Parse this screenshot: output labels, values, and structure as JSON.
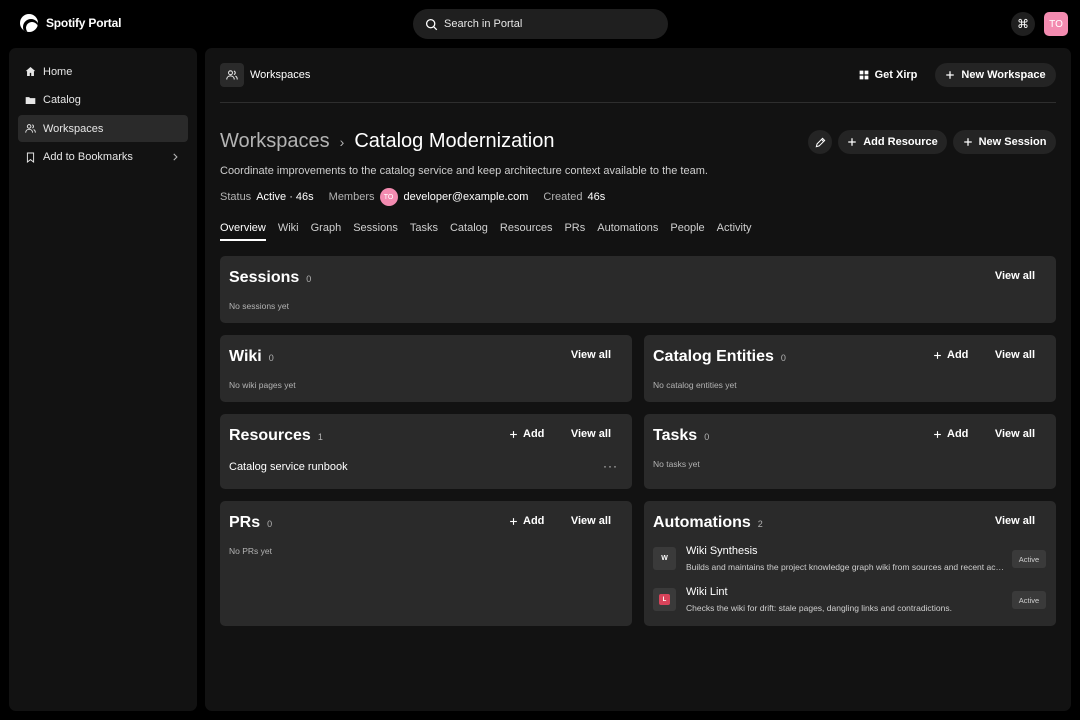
{
  "app": {
    "name": "Spotify Portal"
  },
  "search": {
    "placeholder": "Search in Portal"
  },
  "user": {
    "initials": "TO"
  },
  "sidebar": {
    "items": [
      {
        "label": "Home"
      },
      {
        "label": "Catalog"
      },
      {
        "label": "Workspaces"
      },
      {
        "label": "Add to Bookmarks"
      }
    ]
  },
  "header": {
    "section": "Workspaces",
    "get_xirp": "Get Xirp",
    "new_workspace": "New Workspace"
  },
  "workspace": {
    "breadcrumb": "Workspaces",
    "title": "Catalog Modernization",
    "description": "Coordinate improvements to the catalog service and keep architecture context available to the team.",
    "add_resource": "Add Resource",
    "new_session": "New Session",
    "status_label": "Status",
    "status_value": "Active · 46s",
    "members_label": "Members",
    "member_initials": "TO",
    "member_email": "developer@example.com",
    "created_label": "Created",
    "created_value": "46s"
  },
  "tabs": [
    "Overview",
    "Wiki",
    "Graph",
    "Sessions",
    "Tasks",
    "Catalog",
    "Resources",
    "PRs",
    "Automations",
    "People",
    "Activity"
  ],
  "labels": {
    "view_all": "View all",
    "add": "Add"
  },
  "cards": {
    "sessions": {
      "title": "Sessions",
      "count": "0",
      "empty": "No sessions yet"
    },
    "wiki": {
      "title": "Wiki",
      "count": "0",
      "empty": "No wiki pages yet"
    },
    "catalog": {
      "title": "Catalog Entities",
      "count": "0",
      "empty": "No catalog entities yet"
    },
    "resources": {
      "title": "Resources",
      "count": "1",
      "item": "Catalog service runbook"
    },
    "tasks": {
      "title": "Tasks",
      "count": "0",
      "empty": "No tasks yet"
    },
    "prs": {
      "title": "PRs",
      "count": "0",
      "empty": "No PRs yet"
    },
    "automations": {
      "title": "Automations",
      "count": "2",
      "items": [
        {
          "badge": "W",
          "name": "Wiki Synthesis",
          "desc": "Builds and maintains the project knowledge graph wiki from sources and recent activity.",
          "status": "Active"
        },
        {
          "badge": "L",
          "name": "Wiki Lint",
          "desc": "Checks the wiki for drift: stale pages, dangling links and contradictions.",
          "status": "Active"
        }
      ]
    }
  }
}
